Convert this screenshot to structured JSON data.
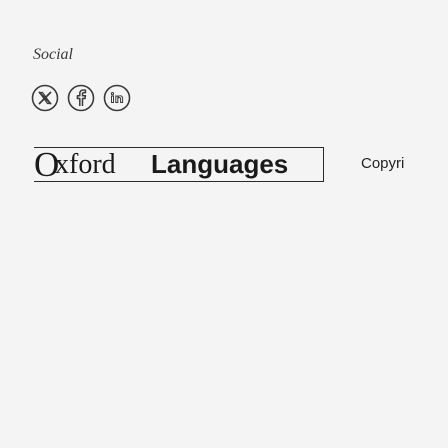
{
  "social": {
    "heading": "Social",
    "links": [
      {
        "icon": "x-twitter-icon"
      },
      {
        "icon": "facebook-icon"
      },
      {
        "icon": "linkedin-icon"
      }
    ]
  },
  "logo": {
    "part_o": "O",
    "part_serif": "xford",
    "part_sans": "Languages"
  },
  "copyright": {
    "text": "Copyri"
  },
  "colors": {
    "background": "#f4f4f4",
    "text": "#3a3a3a"
  }
}
